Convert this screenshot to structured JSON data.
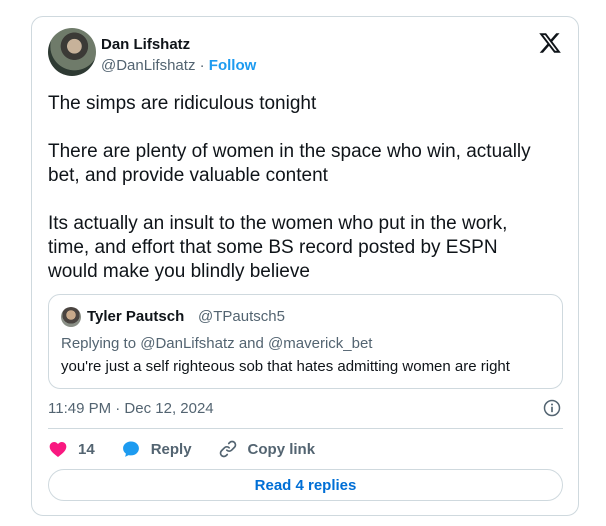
{
  "author": {
    "name": "Dan Lifshatz",
    "handle": "@DanLifshatz",
    "separator": "·",
    "follow_label": "Follow"
  },
  "tweet": {
    "paragraphs": [
      "The simps are ridiculous tonight",
      "There are plenty of women in the space who win, actually\nbet, and provide valuable content",
      "Its actually an insult to the women who put in the work,\ntime, and effort that some BS record posted by ESPN\nwould make you blindly believe"
    ]
  },
  "quoted": {
    "name": "Tyler Pautsch",
    "handle": "@TPautsch5",
    "replying_prefix": "Replying to ",
    "replying_mention_1": "@DanLifshatz",
    "replying_and": " and ",
    "replying_mention_2": "@maverick_bet",
    "text": "you're just a self righteous sob that hates admitting women are right"
  },
  "timestamp": "11:49 PM · Dec 12, 2024",
  "actions": {
    "like_count": "14",
    "reply_label": "Reply",
    "copy_link_label": "Copy link"
  },
  "read_replies_label": "Read 4 replies",
  "colors": {
    "like": "#f91880",
    "reply": "#1d9bf0",
    "link": "#006fd6"
  }
}
